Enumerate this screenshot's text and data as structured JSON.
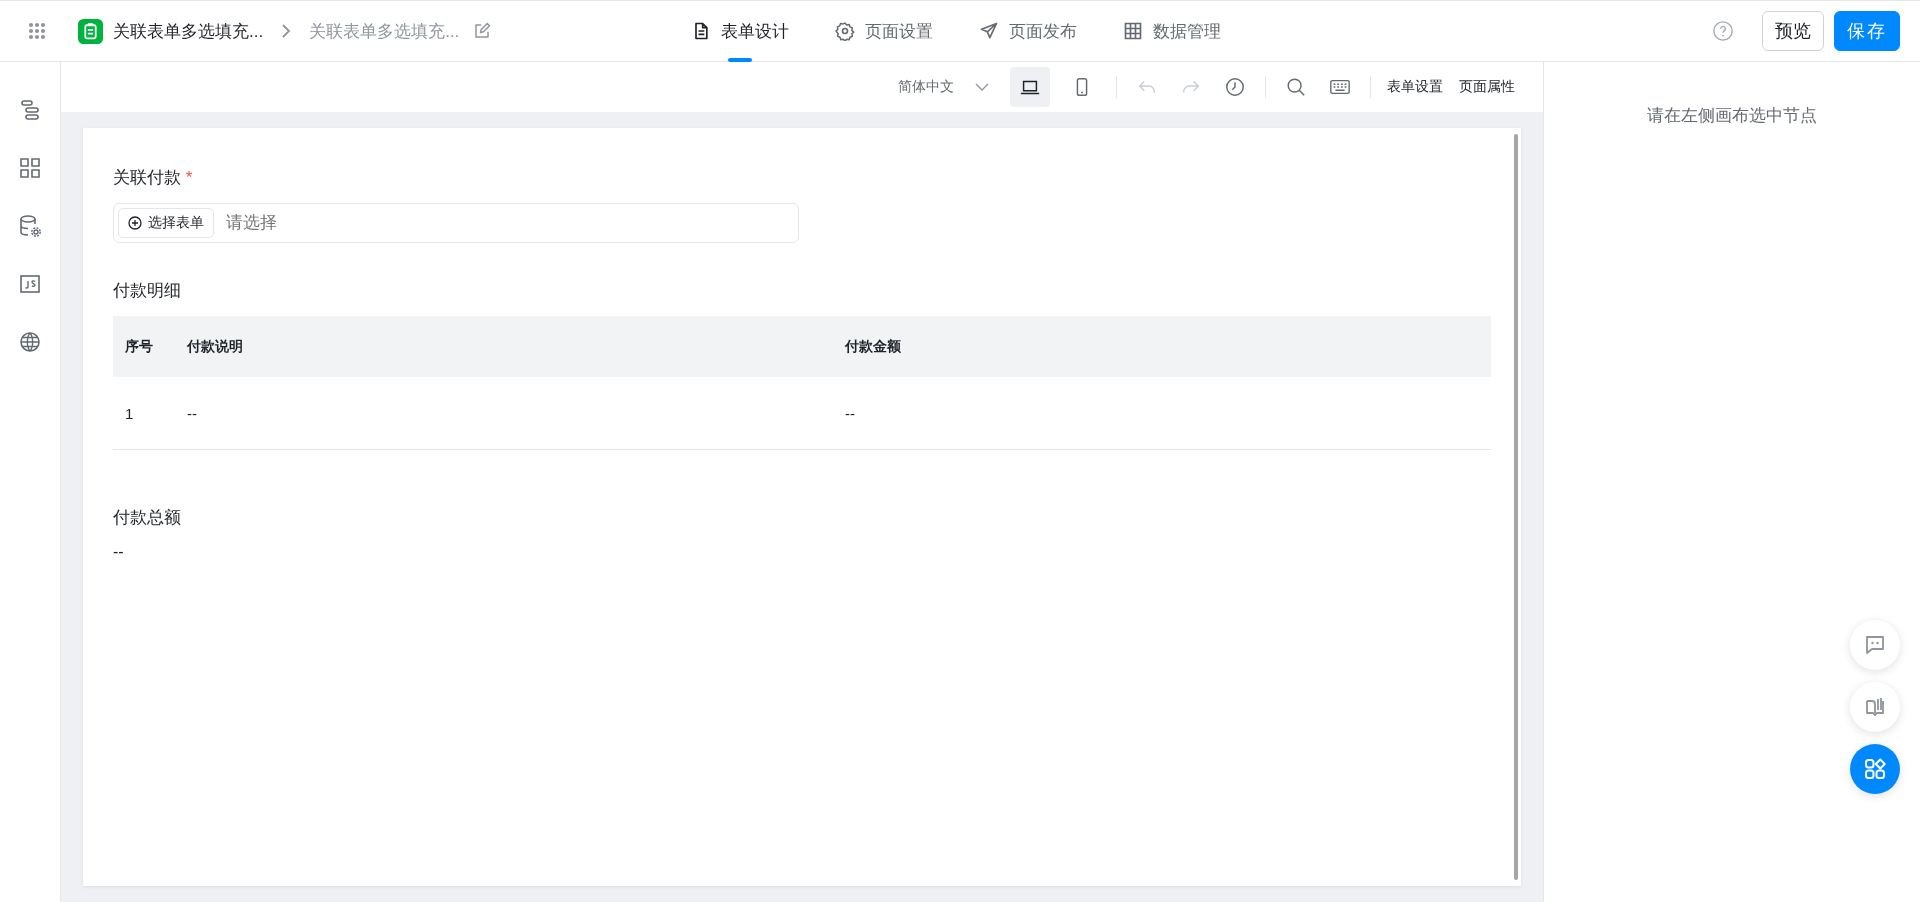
{
  "topbar": {
    "app_title": "关联表单多选填充...",
    "breadcrumb_page": "关联表单多选填充...",
    "tabs": [
      {
        "label": "表单设计",
        "selected": true
      },
      {
        "label": "页面设置",
        "selected": false
      },
      {
        "label": "页面发布",
        "selected": false
      },
      {
        "label": "数据管理",
        "selected": false
      }
    ],
    "buttons": [
      {
        "label": "预览",
        "kind": "default"
      },
      {
        "label": "保存",
        "kind": "primary"
      }
    ]
  },
  "toolbar": {
    "language": "简体中文",
    "devices": [
      {
        "selected": true
      },
      {
        "selected": false
      }
    ],
    "tools": [
      {
        "disabled": true
      },
      {
        "disabled": true
      },
      {
        "disabled": false
      },
      {
        "disabled": false
      },
      {
        "disabled": false
      }
    ],
    "links": [
      "表单设置",
      "页面属性"
    ]
  },
  "form": {
    "fields": [
      {
        "kind": "association",
        "label": "关联付款",
        "required_mark": "*",
        "button": "选择表单",
        "placeholder": "请选择"
      },
      {
        "kind": "table",
        "label": "付款明细",
        "columns": [
          "序号",
          "付款说明",
          "付款金额"
        ],
        "rows": [
          [
            "1",
            "--",
            "--"
          ]
        ]
      },
      {
        "kind": "number",
        "label": "付款总额",
        "value": "--"
      }
    ]
  },
  "props_panel": {
    "hint": "请在左侧画布选中节点"
  },
  "fabs": [
    {
      "kind": "default"
    },
    {
      "kind": "default"
    },
    {
      "kind": "primary"
    }
  ]
}
